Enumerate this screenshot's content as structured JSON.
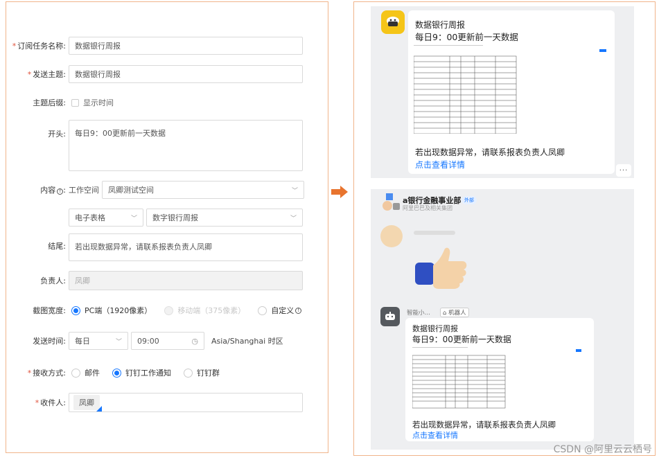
{
  "form": {
    "task_name": {
      "label": "订阅任务名称:",
      "value": "数据银行周报"
    },
    "subject": {
      "label": "发送主题:",
      "value": "数据银行周报"
    },
    "subject_suffix": {
      "label": "主题后缀:",
      "option": "显示时间"
    },
    "opening": {
      "label": "开头:",
      "value": "每日9：00更新前一天数据"
    },
    "content": {
      "label": "内容",
      "workspace_label": "工作空间",
      "workspace_value": "凤卿测试空间",
      "type_value": "电子表格",
      "report_value": "数字银行周报"
    },
    "ending": {
      "label": "结尾:",
      "value": "若出现数据异常，请联系报表负责人凤卿"
    },
    "owner": {
      "label": "负责人:",
      "value": "凤卿"
    },
    "screenshot_width": {
      "label": "截图宽度:",
      "options": [
        "PC端（1920像素）",
        "移动端（375像素）",
        "自定义"
      ]
    },
    "send_time": {
      "label": "发送时间:",
      "frequency": "每日",
      "time": "09:00",
      "timezone": "Asia/Shanghai 时区"
    },
    "receive_method": {
      "label": "接收方式:",
      "options": [
        "邮件",
        "钉钉工作通知",
        "钉钉群"
      ]
    },
    "recipients": {
      "label": "收件人:",
      "tag": "凤卿"
    }
  },
  "preview1": {
    "title": "数据银行周报",
    "subtitle": "每日9：00更新前一天数据",
    "note": "若出现数据异常，请联系报表负责人凤卿",
    "link": "点击查看详情",
    "more": "···"
  },
  "group": {
    "name": "a银行金融事业部",
    "badge": "外部",
    "sub": "阿里巴巴及相关集团"
  },
  "bot": {
    "name": "智能小…",
    "tag": "机器人"
  },
  "preview2": {
    "title": "数据银行周报",
    "subtitle": "每日9：00更新前一天数据",
    "note": "若出现数据异常，请联系报表负责人凤卿",
    "link": "点击查看详情"
  },
  "watermark": "CSDN @阿里云云栖号",
  "colors": {
    "accent": "#1677ff",
    "border": "#f0b48a",
    "arrow": "#e8742e",
    "required": "#e0533c"
  }
}
